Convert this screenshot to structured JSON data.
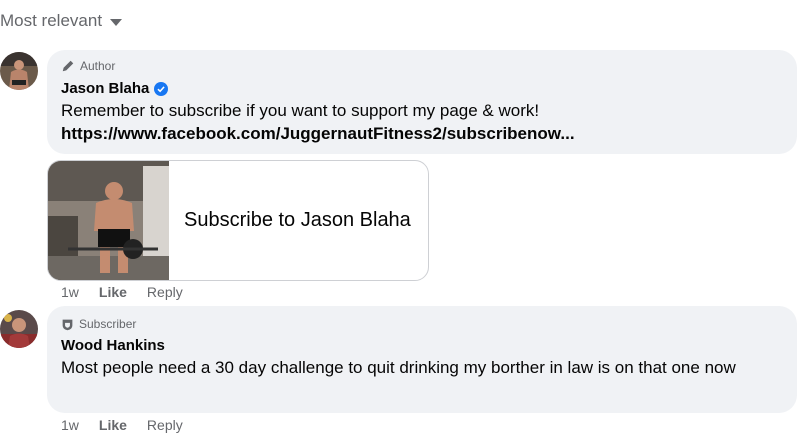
{
  "sort": {
    "label": "Most relevant"
  },
  "comments": [
    {
      "badge": "Author",
      "badge_icon": "pencil-icon",
      "name": "Jason Blaha",
      "verified": true,
      "text": "Remember to subscribe if you want to support my page & work!",
      "link": "https://www.facebook.com/JuggernautFitness2/subscribenow...",
      "preview_title": "Subscribe to Jason Blaha",
      "time": "1w",
      "like": "Like",
      "reply": "Reply"
    },
    {
      "badge": "Subscriber",
      "badge_icon": "shield-icon",
      "name": "Wood Hankins",
      "verified": false,
      "text": "Most people need a 30 day challenge to quit drinking my borther in law is on that one now",
      "time": "1w",
      "like": "Like",
      "reply": "Reply"
    }
  ],
  "colors": {
    "verified": "#1877f2",
    "bubble": "#f0f2f5",
    "muted": "#65676b"
  }
}
